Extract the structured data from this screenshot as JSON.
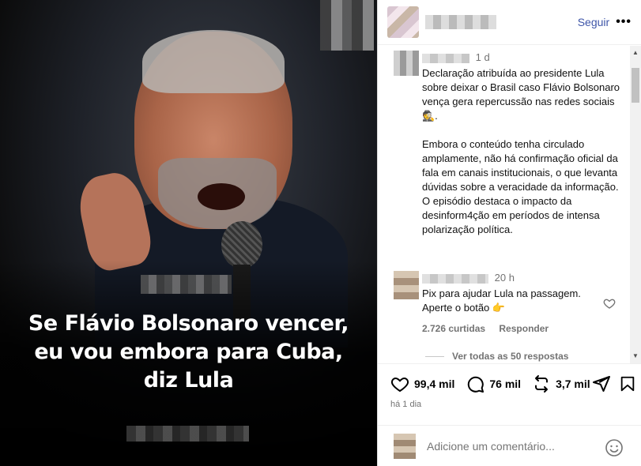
{
  "post": {
    "headline_lines": [
      "Se Flávio Bolsonaro vencer,",
      "eu vou embora para Cuba,",
      "diz Lula"
    ]
  },
  "panel": {
    "follow_label": "Seguir",
    "more_label": "•••"
  },
  "caption": {
    "time": "1 d",
    "text": "Declaração atribuída ao presidente Lula sobre deixar o Brasil caso Flávio Bolsonaro vença gera repercussão nas redes sociais 🕵️.\n\nEmbora o conteúdo tenha circulado amplamente, não há confirmação oficial da fala em canais institucionais, o que levanta dúvidas sobre a veracidade da informação. O episódio destaca o impacto da desinform4ção em períodos de intensa polarização política."
  },
  "comment": {
    "time": "20 h",
    "text": "Pix para ajudar Lula na passagem.\nAperte o botão 👉",
    "likes": "2.726 curtidas",
    "reply_label": "Responder",
    "view_replies": "Ver todas as 50 respostas"
  },
  "actions": {
    "likes": "99,4 mil",
    "comments": "76 mil",
    "reposts": "3,7 mil",
    "date": "há 1 dia"
  },
  "composer": {
    "placeholder": "Adicione um comentário..."
  }
}
